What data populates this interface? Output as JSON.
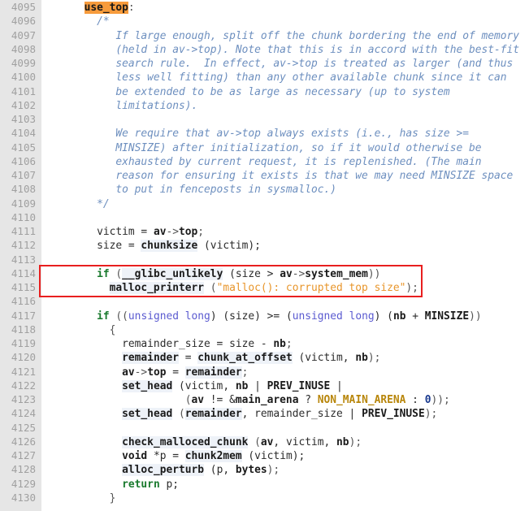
{
  "viewer": {
    "language": "c",
    "first_line_number": 4095,
    "last_line_number": 4130,
    "gutter_background": "#e6e6e6",
    "gutter_text_color": "#a0a0a0",
    "code_background": "#ffffff",
    "search_highlight_color": "#f79b3c",
    "annotation_box_color": "#e81f1f"
  },
  "annotation": {
    "name": "red-highlight-box",
    "covers_lines": [
      4114,
      4115
    ],
    "color": "#e81f1f"
  },
  "search_match": {
    "text": "use_top",
    "line": 4095
  },
  "lines": [
    {
      "n": 4095,
      "tokens": [
        {
          "t": "      ",
          "c": "plain"
        },
        {
          "t": "use_top",
          "c": "hl"
        },
        {
          "t": ":",
          "c": "punc"
        }
      ]
    },
    {
      "n": 4096,
      "tokens": [
        {
          "t": "        /*",
          "c": "cmt"
        }
      ]
    },
    {
      "n": 4097,
      "tokens": [
        {
          "t": "           If large enough, split off the chunk bordering the end of memory",
          "c": "cmt"
        }
      ]
    },
    {
      "n": 4098,
      "tokens": [
        {
          "t": "           (held in av->top). Note that this is in accord with the best-fit",
          "c": "cmt"
        }
      ]
    },
    {
      "n": 4099,
      "tokens": [
        {
          "t": "           search rule.  In effect, av->top is treated as larger (and thus",
          "c": "cmt"
        }
      ]
    },
    {
      "n": 4100,
      "tokens": [
        {
          "t": "           less well fitting) than any other available chunk since it can",
          "c": "cmt"
        }
      ]
    },
    {
      "n": 4101,
      "tokens": [
        {
          "t": "           be extended to be as large as necessary (up to system",
          "c": "cmt"
        }
      ]
    },
    {
      "n": 4102,
      "tokens": [
        {
          "t": "           limitations).",
          "c": "cmt"
        }
      ]
    },
    {
      "n": 4103,
      "tokens": []
    },
    {
      "n": 4104,
      "tokens": [
        {
          "t": "           We require that av->top always exists (i.e., has size >=",
          "c": "cmt"
        }
      ]
    },
    {
      "n": 4105,
      "tokens": [
        {
          "t": "           MINSIZE) after initialization, so if it would otherwise be",
          "c": "cmt"
        }
      ]
    },
    {
      "n": 4106,
      "tokens": [
        {
          "t": "           exhausted by current request, it is replenished. (The main",
          "c": "cmt"
        }
      ]
    },
    {
      "n": 4107,
      "tokens": [
        {
          "t": "           reason for ensuring it exists is that we may need MINSIZE space",
          "c": "cmt"
        }
      ]
    },
    {
      "n": 4108,
      "tokens": [
        {
          "t": "           to put in fenceposts in sysmalloc.)",
          "c": "cmt"
        }
      ]
    },
    {
      "n": 4109,
      "tokens": [
        {
          "t": "        */",
          "c": "cmt"
        }
      ]
    },
    {
      "n": 4110,
      "tokens": []
    },
    {
      "n": 4111,
      "tokens": [
        {
          "t": "        victim = ",
          "c": "plain"
        },
        {
          "t": "av",
          "c": "id"
        },
        {
          "t": "->",
          "c": "punc"
        },
        {
          "t": "top",
          "c": "id"
        },
        {
          "t": ";",
          "c": "punc"
        }
      ]
    },
    {
      "n": 4112,
      "tokens": [
        {
          "t": "        size = ",
          "c": "plain"
        },
        {
          "t": "chunksize",
          "c": "fn"
        },
        {
          "t": " (victim);",
          "c": "plain"
        }
      ]
    },
    {
      "n": 4113,
      "tokens": []
    },
    {
      "n": 4114,
      "tokens": [
        {
          "t": "        ",
          "c": "plain"
        },
        {
          "t": "if",
          "c": "kw"
        },
        {
          "t": " (",
          "c": "punc"
        },
        {
          "t": "__glibc_unlikely",
          "c": "fn"
        },
        {
          "t": " (size > ",
          "c": "plain"
        },
        {
          "t": "av",
          "c": "id"
        },
        {
          "t": "->",
          "c": "punc"
        },
        {
          "t": "system_mem",
          "c": "id"
        },
        {
          "t": "))",
          "c": "punc"
        }
      ]
    },
    {
      "n": 4115,
      "tokens": [
        {
          "t": "          ",
          "c": "plain"
        },
        {
          "t": "malloc_printerr",
          "c": "fn"
        },
        {
          "t": " (",
          "c": "punc"
        },
        {
          "t": "\"malloc(): corrupted top size\"",
          "c": "str"
        },
        {
          "t": ");",
          "c": "punc"
        }
      ]
    },
    {
      "n": 4116,
      "tokens": []
    },
    {
      "n": 4117,
      "tokens": [
        {
          "t": "        ",
          "c": "plain"
        },
        {
          "t": "if",
          "c": "kw"
        },
        {
          "t": " ((",
          "c": "punc"
        },
        {
          "t": "unsigned long",
          "c": "type"
        },
        {
          "t": ") (size) >= (",
          "c": "plain"
        },
        {
          "t": "unsigned long",
          "c": "type"
        },
        {
          "t": ") (",
          "c": "plain"
        },
        {
          "t": "nb",
          "c": "id"
        },
        {
          "t": " + ",
          "c": "plain"
        },
        {
          "t": "MINSIZE",
          "c": "id"
        },
        {
          "t": "))",
          "c": "punc"
        }
      ]
    },
    {
      "n": 4118,
      "tokens": [
        {
          "t": "          {",
          "c": "punc"
        }
      ]
    },
    {
      "n": 4119,
      "tokens": [
        {
          "t": "            remainder_size = size - ",
          "c": "plain"
        },
        {
          "t": "nb",
          "c": "id"
        },
        {
          "t": ";",
          "c": "punc"
        }
      ]
    },
    {
      "n": 4120,
      "tokens": [
        {
          "t": "            ",
          "c": "plain"
        },
        {
          "t": "remainder",
          "c": "fn"
        },
        {
          "t": " = ",
          "c": "plain"
        },
        {
          "t": "chunk_at_offset",
          "c": "fn"
        },
        {
          "t": " (victim, ",
          "c": "plain"
        },
        {
          "t": "nb",
          "c": "id"
        },
        {
          "t": ");",
          "c": "punc"
        }
      ]
    },
    {
      "n": 4121,
      "tokens": [
        {
          "t": "            ",
          "c": "plain"
        },
        {
          "t": "av",
          "c": "id"
        },
        {
          "t": "->",
          "c": "punc"
        },
        {
          "t": "top",
          "c": "id"
        },
        {
          "t": " = ",
          "c": "plain"
        },
        {
          "t": "remainder",
          "c": "fn"
        },
        {
          "t": ";",
          "c": "punc"
        }
      ]
    },
    {
      "n": 4122,
      "tokens": [
        {
          "t": "            ",
          "c": "plain"
        },
        {
          "t": "set_head",
          "c": "fn"
        },
        {
          "t": " (victim, ",
          "c": "plain"
        },
        {
          "t": "nb",
          "c": "id"
        },
        {
          "t": " | ",
          "c": "plain"
        },
        {
          "t": "PREV_INUSE",
          "c": "id"
        },
        {
          "t": " |",
          "c": "plain"
        }
      ]
    },
    {
      "n": 4123,
      "tokens": [
        {
          "t": "                      (",
          "c": "punc"
        },
        {
          "t": "av",
          "c": "id"
        },
        {
          "t": " != &",
          "c": "plain"
        },
        {
          "t": "main_arena",
          "c": "id"
        },
        {
          "t": " ? ",
          "c": "plain"
        },
        {
          "t": "NON_MAIN_ARENA",
          "c": "macro"
        },
        {
          "t": " : ",
          "c": "plain"
        },
        {
          "t": "0",
          "c": "num"
        },
        {
          "t": "));",
          "c": "punc"
        }
      ]
    },
    {
      "n": 4124,
      "tokens": [
        {
          "t": "            ",
          "c": "plain"
        },
        {
          "t": "set_head",
          "c": "fn"
        },
        {
          "t": " (",
          "c": "punc"
        },
        {
          "t": "remainder",
          "c": "fn"
        },
        {
          "t": ", remainder_size | ",
          "c": "plain"
        },
        {
          "t": "PREV_INUSE",
          "c": "id"
        },
        {
          "t": ");",
          "c": "punc"
        }
      ]
    },
    {
      "n": 4125,
      "tokens": []
    },
    {
      "n": 4126,
      "tokens": [
        {
          "t": "            ",
          "c": "plain"
        },
        {
          "t": "check_malloced_chunk",
          "c": "fn"
        },
        {
          "t": " (",
          "c": "punc"
        },
        {
          "t": "av",
          "c": "id"
        },
        {
          "t": ", victim, ",
          "c": "plain"
        },
        {
          "t": "nb",
          "c": "id"
        },
        {
          "t": ");",
          "c": "punc"
        }
      ]
    },
    {
      "n": 4127,
      "tokens": [
        {
          "t": "            ",
          "c": "plain"
        },
        {
          "t": "void",
          "c": "id"
        },
        {
          "t": " *p = ",
          "c": "plain"
        },
        {
          "t": "chunk2mem",
          "c": "fn"
        },
        {
          "t": " (victim);",
          "c": "plain"
        }
      ]
    },
    {
      "n": 4128,
      "tokens": [
        {
          "t": "            ",
          "c": "plain"
        },
        {
          "t": "alloc_perturb",
          "c": "fn"
        },
        {
          "t": " (p, ",
          "c": "plain"
        },
        {
          "t": "bytes",
          "c": "id"
        },
        {
          "t": ");",
          "c": "punc"
        }
      ]
    },
    {
      "n": 4129,
      "tokens": [
        {
          "t": "            ",
          "c": "plain"
        },
        {
          "t": "return",
          "c": "kw"
        },
        {
          "t": " p;",
          "c": "plain"
        }
      ]
    },
    {
      "n": 4130,
      "tokens": [
        {
          "t": "          }",
          "c": "punc"
        }
      ]
    }
  ]
}
